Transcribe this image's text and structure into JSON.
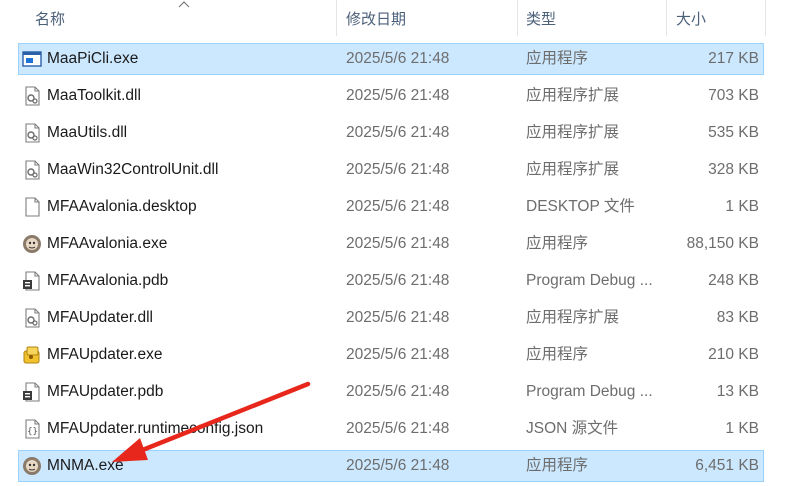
{
  "columns": {
    "name": "名称",
    "date": "修改日期",
    "type": "类型",
    "size": "大小"
  },
  "files": [
    {
      "name": "MaaPiCli.exe",
      "date": "2025/5/6 21:48",
      "type": "应用程序",
      "size": "217 KB",
      "icon": "console-app-icon",
      "selected": true
    },
    {
      "name": "MaaToolkit.dll",
      "date": "2025/5/6 21:48",
      "type": "应用程序扩展",
      "size": "703 KB",
      "icon": "dll-file-icon",
      "selected": false
    },
    {
      "name": "MaaUtils.dll",
      "date": "2025/5/6 21:48",
      "type": "应用程序扩展",
      "size": "535 KB",
      "icon": "dll-file-icon",
      "selected": false
    },
    {
      "name": "MaaWin32ControlUnit.dll",
      "date": "2025/5/6 21:48",
      "type": "应用程序扩展",
      "size": "328 KB",
      "icon": "dll-file-icon",
      "selected": false
    },
    {
      "name": "MFAAvalonia.desktop",
      "date": "2025/5/6 21:48",
      "type": "DESKTOP 文件",
      "size": "1 KB",
      "icon": "blank-file-icon",
      "selected": false
    },
    {
      "name": "MFAAvalonia.exe",
      "date": "2025/5/6 21:48",
      "type": "应用程序",
      "size": "88,150 KB",
      "icon": "app-avatar-icon",
      "selected": false
    },
    {
      "name": "MFAAvalonia.pdb",
      "date": "2025/5/6 21:48",
      "type": "Program Debug ...",
      "size": "248 KB",
      "icon": "pdb-file-icon",
      "selected": false
    },
    {
      "name": "MFAUpdater.dll",
      "date": "2025/5/6 21:48",
      "type": "应用程序扩展",
      "size": "83 KB",
      "icon": "dll-file-icon",
      "selected": false
    },
    {
      "name": "MFAUpdater.exe",
      "date": "2025/5/6 21:48",
      "type": "应用程序",
      "size": "210 KB",
      "icon": "updater-app-icon",
      "selected": false
    },
    {
      "name": "MFAUpdater.pdb",
      "date": "2025/5/6 21:48",
      "type": "Program Debug ...",
      "size": "13 KB",
      "icon": "pdb-file-icon",
      "selected": false
    },
    {
      "name": "MFAUpdater.runtimeconfig.json",
      "date": "2025/5/6 21:48",
      "type": "JSON 源文件",
      "size": "1 KB",
      "icon": "json-file-icon",
      "selected": false
    },
    {
      "name": "MNMA.exe",
      "date": "2025/5/6 21:48",
      "type": "应用程序",
      "size": "6,451 KB",
      "icon": "app-avatar-icon",
      "selected": true
    }
  ],
  "colors": {
    "selection_bg": "#cce8ff",
    "selection_border": "#99d1ff",
    "annotation_arrow": "#e8271c"
  }
}
